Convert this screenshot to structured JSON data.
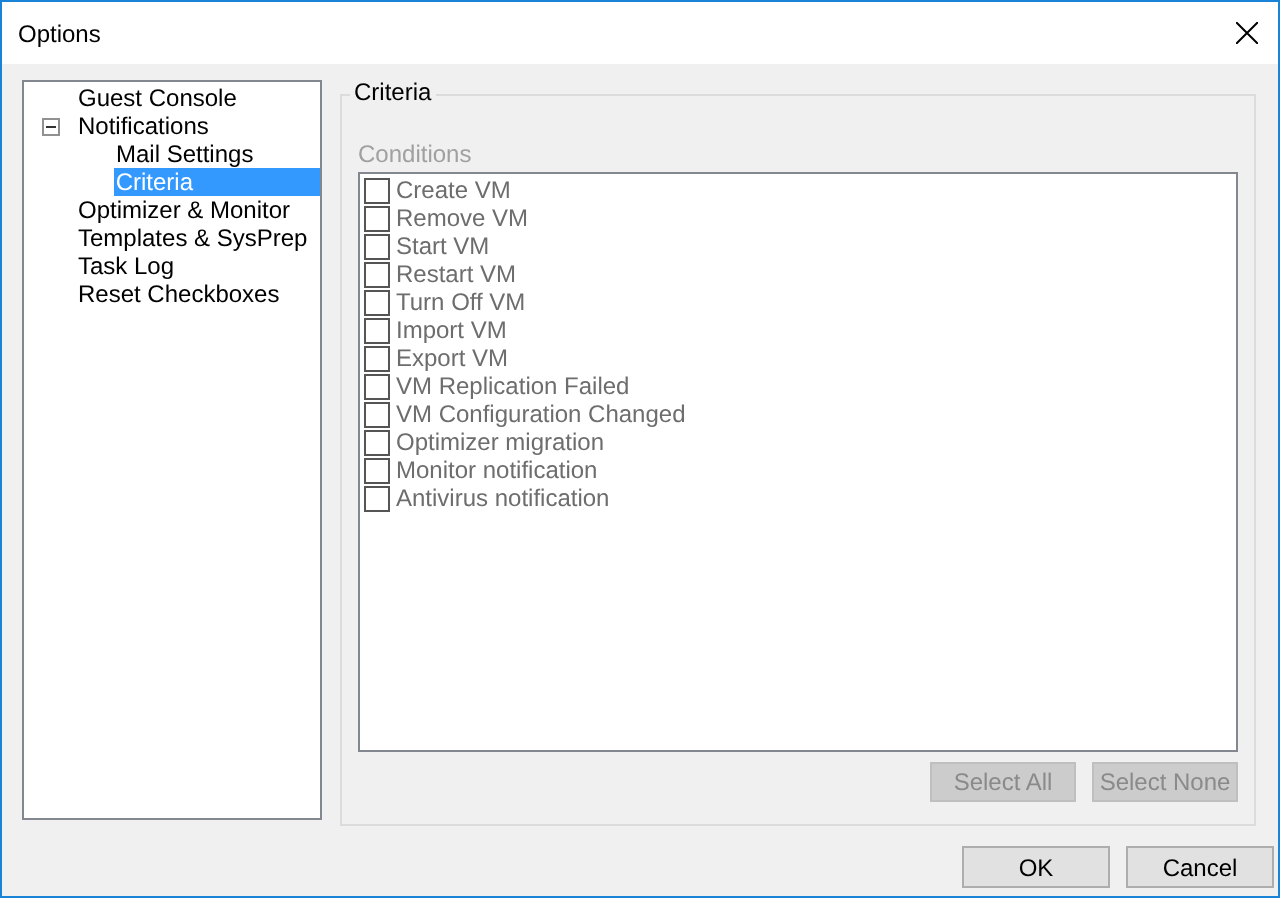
{
  "window": {
    "title": "Options"
  },
  "tree": [
    {
      "label": "Guest Console",
      "selected": false
    },
    {
      "label": "Notifications",
      "selected": false,
      "expanded": true,
      "children": [
        {
          "label": "Mail Settings",
          "selected": false
        },
        {
          "label": "Criteria",
          "selected": true
        }
      ]
    },
    {
      "label": "Optimizer & Monitor",
      "selected": false
    },
    {
      "label": "Templates & SysPrep",
      "selected": false
    },
    {
      "label": "Task Log",
      "selected": false
    },
    {
      "label": "Reset Checkboxes",
      "selected": false
    }
  ],
  "group": {
    "title": "Criteria",
    "list_label": "Conditions",
    "disabled": true,
    "conditions": [
      {
        "label": "Create VM",
        "checked": false
      },
      {
        "label": "Remove VM",
        "checked": false
      },
      {
        "label": "Start VM",
        "checked": false
      },
      {
        "label": "Restart VM",
        "checked": false
      },
      {
        "label": "Turn Off VM",
        "checked": false
      },
      {
        "label": "Import VM",
        "checked": false
      },
      {
        "label": "Export VM",
        "checked": false
      },
      {
        "label": "VM Replication Failed",
        "checked": false
      },
      {
        "label": "VM Configuration Changed",
        "checked": false
      },
      {
        "label": "Optimizer migration",
        "checked": false
      },
      {
        "label": "Monitor notification",
        "checked": false
      },
      {
        "label": "Antivirus notification",
        "checked": false
      }
    ],
    "buttons": [
      {
        "label": "Select All",
        "disabled": true
      },
      {
        "label": "Select None",
        "disabled": true
      }
    ]
  },
  "buttons": [
    {
      "label": "OK"
    },
    {
      "label": "Cancel"
    }
  ]
}
